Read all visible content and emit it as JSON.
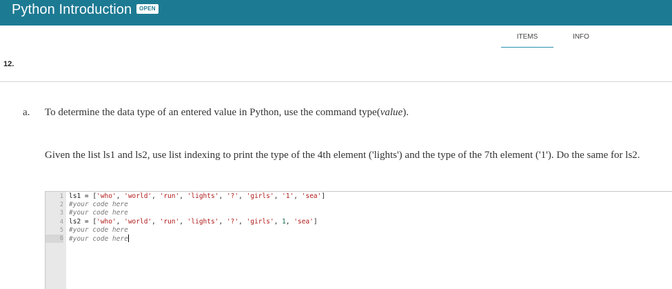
{
  "header": {
    "title": "Python Introduction",
    "status": "OPEN"
  },
  "tabs": [
    {
      "label": "ITEMS",
      "active": true
    },
    {
      "label": "INFO",
      "active": false
    }
  ],
  "question": {
    "number": "12.",
    "part_letter": "a.",
    "instruction_prefix": "To determine the data type of an entered value in Python, use the command type(",
    "instruction_arg": "value",
    "instruction_suffix": ").",
    "prompt": "Given the list ls1 and ls2, use list indexing to print the type of the 4th element ('lights') and the type of the 7th element ('1'). Do the same for ls2."
  },
  "editor": {
    "lines": [
      {
        "num": "1",
        "text": "ls1 = ['who', 'world', 'run', 'lights', '?', 'girls', '1', 'sea']"
      },
      {
        "num": "2",
        "text": "#your code here"
      },
      {
        "num": "3",
        "text": "#your code here"
      },
      {
        "num": "4",
        "text": "ls2 = ['who', 'world', 'run', 'lights', '?', 'girls', 1, 'sea']"
      },
      {
        "num": "5",
        "text": "#your code here"
      },
      {
        "num": "6",
        "text": "#your code here"
      }
    ],
    "active_line": 6
  },
  "colors": {
    "header_bg": "#1d7a93",
    "tab_underline": "#2a8fad",
    "string": "#b11a1a",
    "number": "#116644",
    "comment": "#777777"
  }
}
